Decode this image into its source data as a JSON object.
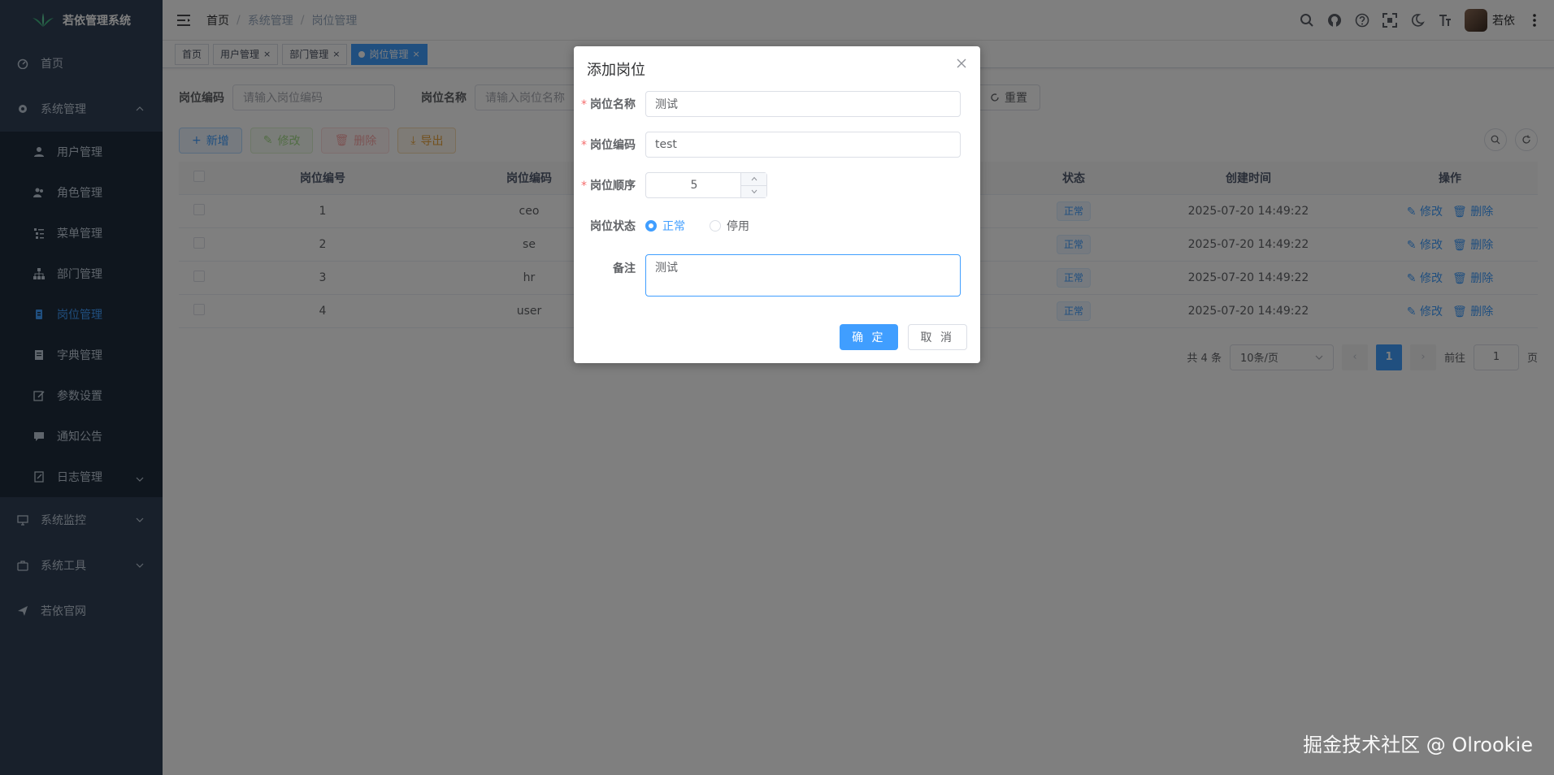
{
  "app": {
    "title": "若依管理系统"
  },
  "sidebar": {
    "items": [
      {
        "label": "首页",
        "icon": "dashboard-icon"
      },
      {
        "label": "系统管理",
        "icon": "system-icon"
      }
    ],
    "sub_items": [
      {
        "label": "用户管理",
        "icon": "user-icon"
      },
      {
        "label": "角色管理",
        "icon": "peoples-icon"
      },
      {
        "label": "菜单管理",
        "icon": "tree-table-icon"
      },
      {
        "label": "部门管理",
        "icon": "tree-icon"
      },
      {
        "label": "岗位管理",
        "icon": "post-icon"
      },
      {
        "label": "字典管理",
        "icon": "dict-icon"
      },
      {
        "label": "参数设置",
        "icon": "edit-icon"
      },
      {
        "label": "通知公告",
        "icon": "message-icon"
      },
      {
        "label": "日志管理",
        "icon": "log-icon"
      }
    ],
    "bottom_items": [
      {
        "label": "系统监控",
        "icon": "monitor-icon"
      },
      {
        "label": "系统工具",
        "icon": "tool-icon"
      },
      {
        "label": "若依官网",
        "icon": "guide-icon"
      }
    ],
    "active_color": "#409eff"
  },
  "header": {
    "breadcrumb": [
      "首页",
      "系统管理",
      "岗位管理"
    ],
    "separator": "/",
    "user_name": "若依"
  },
  "tags": [
    {
      "label": "首页"
    },
    {
      "label": "用户管理",
      "close": "×"
    },
    {
      "label": "部门管理",
      "close": "×"
    },
    {
      "label": "岗位管理",
      "close": "×"
    }
  ],
  "search": {
    "code_label": "岗位编码",
    "code_placeholder": "请输入岗位编码",
    "name_label": "岗位名称",
    "name_placeholder": "请输入岗位名称",
    "reset_label": "重置"
  },
  "toolbar": {
    "add": "新增",
    "edit": "修改",
    "delete": "删除",
    "export": "导出"
  },
  "table": {
    "columns": [
      "岗位编号",
      "岗位编码",
      "状态",
      "创建时间",
      "操作"
    ],
    "rows": [
      {
        "id": "1",
        "code": "ceo",
        "status": "正常",
        "created": "2025-07-20 14:49:22"
      },
      {
        "id": "2",
        "code": "se",
        "status": "正常",
        "created": "2025-07-20 14:49:22"
      },
      {
        "id": "3",
        "code": "hr",
        "status": "正常",
        "created": "2025-07-20 14:49:22"
      },
      {
        "id": "4",
        "code": "user",
        "status": "正常",
        "created": "2025-07-20 14:49:22"
      }
    ],
    "edit_label": "修改",
    "delete_label": "删除"
  },
  "pagination": {
    "total": "共 4 条",
    "page_size": "10条/页",
    "current": "1",
    "goto_prefix": "前往",
    "goto_value": "1",
    "goto_suffix": "页"
  },
  "dialog": {
    "title": "添加岗位",
    "required_mark": "*",
    "fields": {
      "name_label": "岗位名称",
      "name_value": "测试",
      "code_label": "岗位编码",
      "code_value": "test",
      "order_label": "岗位顺序",
      "order_value": "5",
      "status_label": "岗位状态",
      "status_normal": "正常",
      "status_disabled": "停用",
      "remark_label": "备注",
      "remark_value": "测试"
    },
    "confirm": "确 定",
    "cancel": "取 消"
  },
  "watermark": "掘金技术社区 @ Olrookie"
}
